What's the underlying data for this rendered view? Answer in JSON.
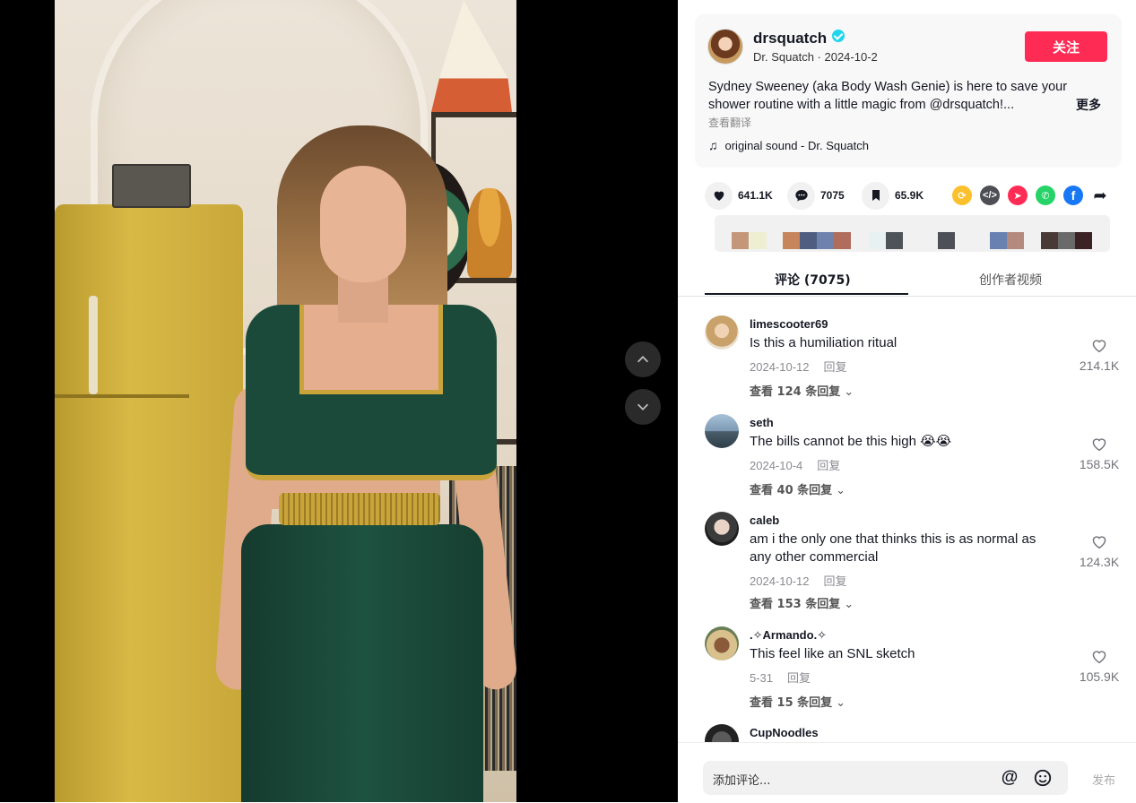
{
  "video": {
    "nav_up": "chevron-up-icon",
    "nav_down": "chevron-down-icon"
  },
  "author": {
    "handle": "drsquatch",
    "sub": "Dr. Squatch · 2024-10-2",
    "follow_label": "关注",
    "description": "Sydney Sweeney (aka Body Wash Genie) is here to save your shower routine with a little magic from @drsquatch!...",
    "more_label": "更多",
    "translate_label": "查看翻译",
    "music": "original sound - Dr. Squatch"
  },
  "actions": {
    "likes": "641.1K",
    "comments": "7075",
    "saves": "65.9K"
  },
  "share_icons": [
    "repost-icon",
    "embed-icon",
    "send-icon",
    "whatsapp-icon",
    "facebook-icon",
    "share-arrow-icon"
  ],
  "colors": {
    "accent": "#fe2c55",
    "verified": "#20d5ec",
    "swatches": [
      "#c5977a",
      "#eeeed2",
      "#c6855a",
      "#4f5e80",
      "#6f82ae",
      "#b06d5c",
      "#e7f1f1",
      "#4e5358",
      "#4d5157",
      "#6782b0",
      "#b58a7e",
      "#4a3a37",
      "#6a6a6a",
      "#3a2225"
    ]
  },
  "tabs": {
    "comments": "评论 (7075)",
    "creator_videos": "创作者视频"
  },
  "comments": [
    {
      "user": "limescooter69",
      "text": "Is this a humiliation ritual",
      "date": "2024-10-12",
      "reply": "回复",
      "replies": "查看 124 条回复",
      "likes": "214.1K"
    },
    {
      "user": "seth",
      "text": "The bills cannot be this high 😭😭",
      "date": "2024-10-4",
      "reply": "回复",
      "replies": "查看 40 条回复",
      "likes": "158.5K"
    },
    {
      "user": "caleb",
      "text": "am i the only one that thinks this is as normal as any other commercial",
      "date": "2024-10-12",
      "reply": "回复",
      "replies": "查看 153 条回复",
      "likes": "124.3K"
    },
    {
      "user": ".✧Armando.✧",
      "text": "This feel like an SNL sketch",
      "date": "5-31",
      "reply": "回复",
      "replies": "查看 15 条回复",
      "likes": "105.9K"
    },
    {
      "user": "CupNoodles",
      "text": "",
      "date": "",
      "reply": "",
      "replies": "",
      "likes": ""
    }
  ],
  "composer": {
    "placeholder": "添加评论...",
    "at_symbol": "@",
    "post_label": "发布"
  }
}
